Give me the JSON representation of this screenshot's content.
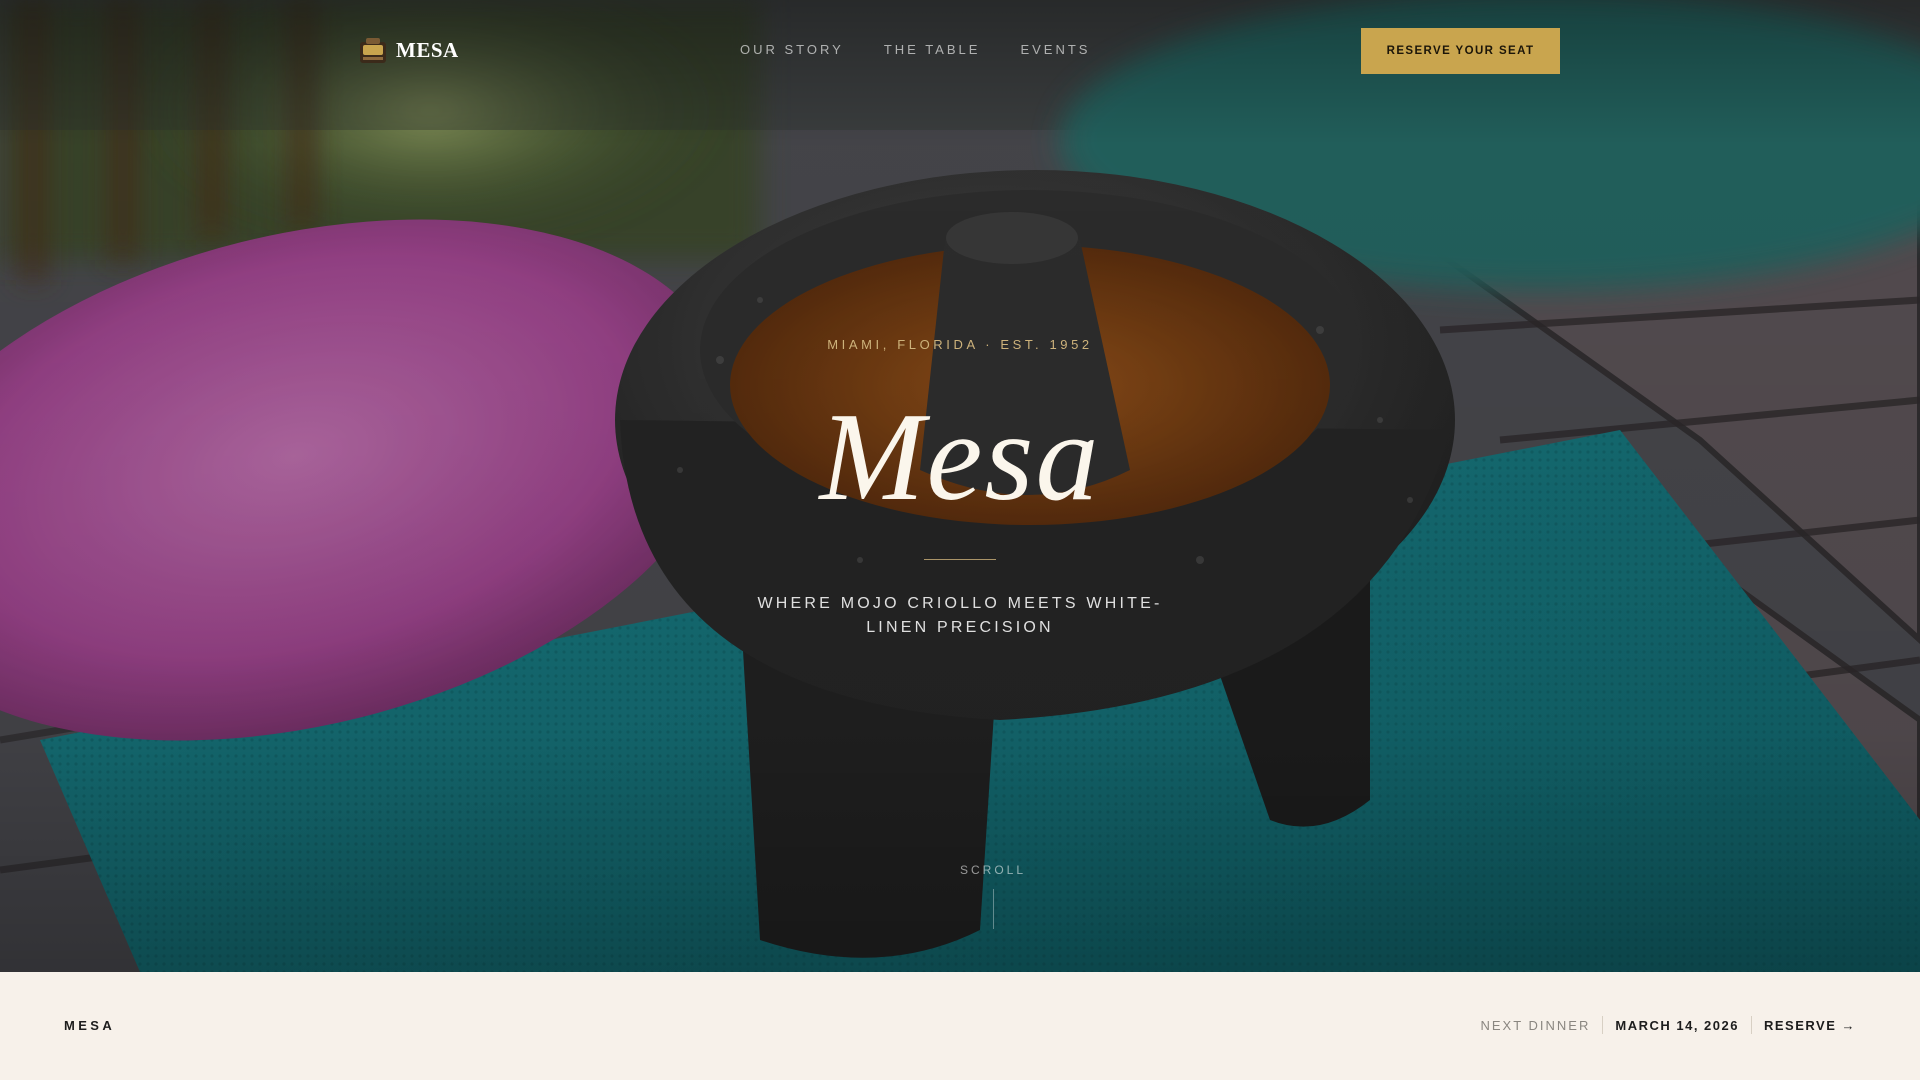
{
  "nav": {
    "brand": "MESA",
    "links": [
      "OUR STORY",
      "THE TABLE",
      "EVENTS"
    ],
    "cta_label": "RESERVE YOUR SEAT"
  },
  "hero": {
    "eyebrow": "MIAMI, FLORIDA · EST. 1952",
    "title": "Mesa",
    "tagline": "WHERE MOJO CRIOLLO MEETS WHITE-LINEN PRECISION",
    "scroll_label": "SCROLL",
    "background_image": "molcajete-salsa-on-colorful-placemats"
  },
  "footer": {
    "brand": "MESA",
    "next_label": "NEXT DINNER",
    "next_date": "MARCH 14, 2026",
    "reserve_label": "RESERVE →"
  },
  "colors": {
    "accent_gold": "#c9a54e",
    "footer_bg": "#f7f1ea",
    "title_text": "#fbf6ec"
  }
}
